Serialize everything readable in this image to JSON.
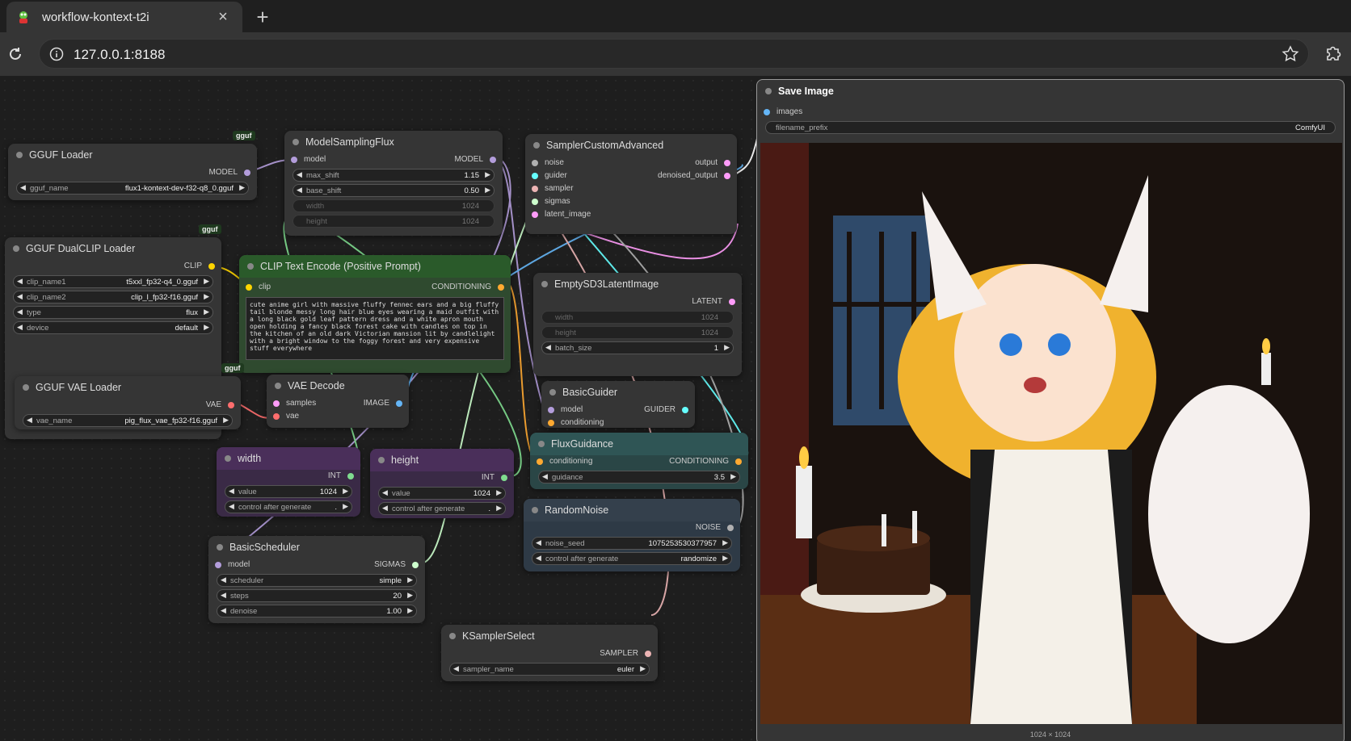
{
  "browser": {
    "tab_title": "workflow-kontext-t2i",
    "url": "127.0.0.1:8188"
  },
  "nodes": {
    "gguf_loader": {
      "title": "GGUF Loader",
      "badge": "gguf",
      "out_model": "MODEL",
      "w_name_label": "gguf_name",
      "w_name_value": "flux1-kontext-dev-f32-q8_0.gguf"
    },
    "model_sampling_flux": {
      "title": "ModelSamplingFlux",
      "in_model": "model",
      "out_model": "MODEL",
      "max_shift_label": "max_shift",
      "max_shift": "1.15",
      "base_shift_label": "base_shift",
      "base_shift": "0.50",
      "width_label": "width",
      "width": "1024",
      "height_label": "height",
      "height": "1024"
    },
    "sampler_custom_advanced": {
      "title": "SamplerCustomAdvanced",
      "in_noise": "noise",
      "in_guider": "guider",
      "in_sampler": "sampler",
      "in_sigmas": "sigmas",
      "in_latent": "latent_image",
      "out_output": "output",
      "out_denoised": "denoised_output"
    },
    "dualclip": {
      "title": "GGUF DualCLIP Loader",
      "badge": "gguf",
      "out_clip": "CLIP",
      "clip1_label": "clip_name1",
      "clip1": "t5xxl_fp32-q4_0.gguf",
      "clip2_label": "clip_name2",
      "clip2": "clip_l_fp32-f16.gguf",
      "type_label": "type",
      "type": "flux",
      "device_label": "device",
      "device": "default"
    },
    "clip_text_encode": {
      "title": "CLIP Text Encode (Positive Prompt)",
      "in_clip": "clip",
      "out_cond": "CONDITIONING",
      "text": "cute anime girl with massive fluffy fennec ears and a big fluffy tail blonde messy long hair blue eyes wearing a maid outfit with a long black gold leaf pattern dress and a white apron mouth open holding a fancy black forest cake with candles on top in the kitchen of an old dark Victorian mansion lit by candlelight with a bright window to the foggy forest and very expensive stuff everywhere"
    },
    "empty_latent": {
      "title": "EmptySD3LatentImage",
      "out_latent": "LATENT",
      "width_label": "width",
      "width": "1024",
      "height_label": "height",
      "height": "1024",
      "batch_label": "batch_size",
      "batch": "1"
    },
    "vae_loader": {
      "title": "GGUF VAE Loader",
      "badge": "gguf",
      "out_vae": "VAE",
      "vae_label": "vae_name",
      "vae": "pig_flux_vae_fp32-f16.gguf"
    },
    "vae_decode": {
      "title": "VAE Decode",
      "in_samples": "samples",
      "in_vae": "vae",
      "out_image": "IMAGE"
    },
    "basic_guider": {
      "title": "BasicGuider",
      "in_model": "model",
      "in_cond": "conditioning",
      "out_guider": "GUIDER"
    },
    "width_node": {
      "title": "width",
      "out_int": "INT",
      "value_label": "value",
      "value": "1024",
      "control_label": "control after generate",
      "control": "."
    },
    "height_node": {
      "title": "height",
      "out_int": "INT",
      "value_label": "value",
      "value": "1024",
      "control_label": "control after generate",
      "control": "."
    },
    "flux_guidance": {
      "title": "FluxGuidance",
      "in_cond": "conditioning",
      "out_cond": "CONDITIONING",
      "guidance_label": "guidance",
      "guidance": "3.5"
    },
    "random_noise": {
      "title": "RandomNoise",
      "out_noise": "NOISE",
      "seed_label": "noise_seed",
      "seed": "1075253530377957",
      "control_label": "control after generate",
      "control": "randomize"
    },
    "basic_scheduler": {
      "title": "BasicScheduler",
      "in_model": "model",
      "out_sigmas": "SIGMAS",
      "scheduler_label": "scheduler",
      "scheduler": "simple",
      "steps_label": "steps",
      "steps": "20",
      "denoise_label": "denoise",
      "denoise": "1.00"
    },
    "ksampler_select": {
      "title": "KSamplerSelect",
      "out_sampler": "SAMPLER",
      "sampler_label": "sampler_name",
      "sampler": "euler"
    },
    "save_image": {
      "title": "Save Image",
      "in_images": "images",
      "prefix_label": "filename_prefix",
      "prefix": "ComfyUI",
      "preview_caption": "1024 × 1024"
    }
  },
  "colors": {
    "model": "#b39ddb",
    "clip": "#ffd500",
    "conditioning": "#ffa931",
    "vae": "#ff6e6e",
    "latent": "#ff9cf9",
    "image": "#64b5f6",
    "int": "#7fdc8f",
    "sigmas": "#cdffcd",
    "sampler": "#ecb4b4",
    "guider": "#66ffff",
    "noise": "#b0b0b0"
  }
}
